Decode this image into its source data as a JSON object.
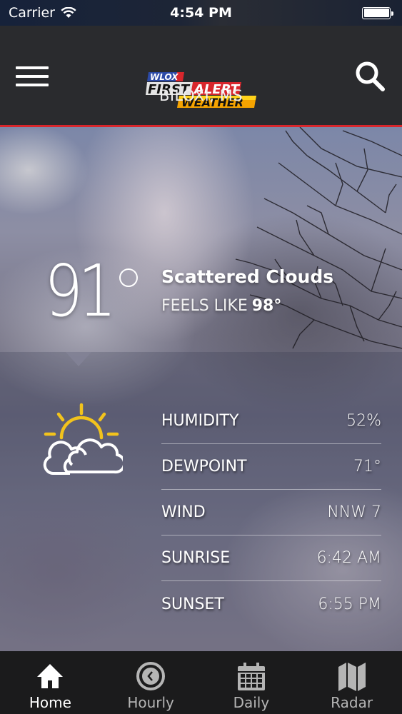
{
  "status_bar": {
    "carrier": "Carrier",
    "time": "4:54 PM",
    "wifi_icon": "wifi-icon",
    "battery_icon": "battery-icon",
    "battery_level_percent": 100
  },
  "header": {
    "menu_icon": "hamburger-menu-icon",
    "search_icon": "search-icon",
    "logo": {
      "station": "WLOX",
      "line1_a": "FIRST",
      "line1_b": "ALERT",
      "line2": "WEATHER"
    },
    "city": "BILOXI, MS",
    "accent_color": "#d8262c"
  },
  "current": {
    "temperature": "91",
    "condition": "Scattered Clouds",
    "feels_like_label": "FEELS LIKE",
    "feels_like_value": "98°",
    "icon": "partly-cloudy-icon"
  },
  "details": [
    {
      "label": "HUMIDITY",
      "value": "52%"
    },
    {
      "label": "DEWPOINT",
      "value": "71°"
    },
    {
      "label": "WIND",
      "value": "NNW 7"
    },
    {
      "label": "SUNRISE",
      "value": "6:42 AM"
    },
    {
      "label": "SUNSET",
      "value": "6:55 PM"
    }
  ],
  "tabs": [
    {
      "label": "Home",
      "icon": "home-icon",
      "active": true
    },
    {
      "label": "Hourly",
      "icon": "clock-icon",
      "active": false
    },
    {
      "label": "Daily",
      "icon": "calendar-icon",
      "active": false
    },
    {
      "label": "Radar",
      "icon": "map-icon",
      "active": false
    }
  ]
}
